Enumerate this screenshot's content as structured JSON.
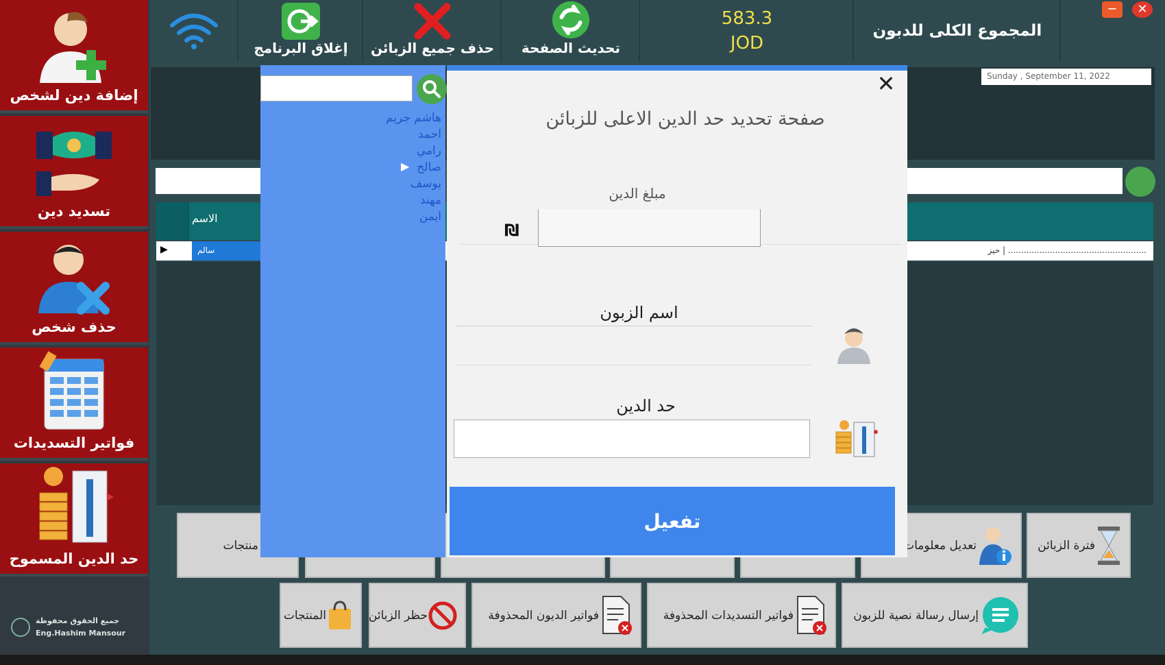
{
  "sidebar": {
    "items": [
      {
        "label": "إضافة دين لشخص",
        "icon": "add-person-icon"
      },
      {
        "label": "تسديد دين",
        "icon": "handshake-money-icon"
      },
      {
        "label": "حذف شخص",
        "icon": "delete-person-icon"
      },
      {
        "label": "فواتير التسديدات",
        "icon": "invoice-sheet-icon"
      },
      {
        "label": "حد الدين المسموح",
        "icon": "coin-limit-icon"
      }
    ],
    "copyright_line1": "جميع الحقوق محفوظة",
    "copyright_line2": "Eng.Hashim Mansour"
  },
  "topbar": {
    "wifi_icon": "wifi-icon",
    "close_program": "إغلاق البرنامج",
    "delete_all_customers": "حذف جميع الزبائن",
    "refresh_page": "تحديث الصفحة",
    "total_amount": "583.3",
    "total_currency": "JOD",
    "total_label": "المجموع الكلى للدبون"
  },
  "date": "Sunday    , September 11, 2022",
  "grid": {
    "header_name": "الاسم",
    "row_name": "سالم",
    "row_right": "حيز | ....................................................."
  },
  "bottom_row1": [
    {
      "label": "إضافة منتجات"
    },
    {
      "label": ""
    },
    {
      "label": ""
    },
    {
      "label": ""
    },
    {
      "label": ""
    },
    {
      "label": "تعديل معلومات"
    },
    {
      "label": "فترة الزبائن"
    }
  ],
  "bottom_row2": [
    {
      "label": "المنتجات"
    },
    {
      "label": "حظر الزبائن"
    },
    {
      "label": "فواتير الديون المحذوفة"
    },
    {
      "label": "فواتير التسديدات المحذوفة"
    },
    {
      "label": "إرسال رسالة نصية للزبون"
    }
  ],
  "customers": [
    "هاشم جريم",
    "احمد",
    "رامي",
    "صالح",
    "يوسف",
    "مهند",
    "ايمن"
  ],
  "modal": {
    "title": "صفحة تحديد حد الدين الاعلى للزبائن",
    "amount_label": "مبلغ الدين",
    "currency_symbol": "₪",
    "name_label": "اسم الزبون",
    "limit_label": "حد الدين",
    "activate_button": "تفعيل",
    "close": "✕"
  },
  "colors": {
    "sidebar_red": "#9a0f12",
    "teal_dark": "#2f4a4f",
    "list_blue": "#5b94ee",
    "accent_blue": "#3f86ec",
    "total_yellow": "#f0e04a"
  }
}
